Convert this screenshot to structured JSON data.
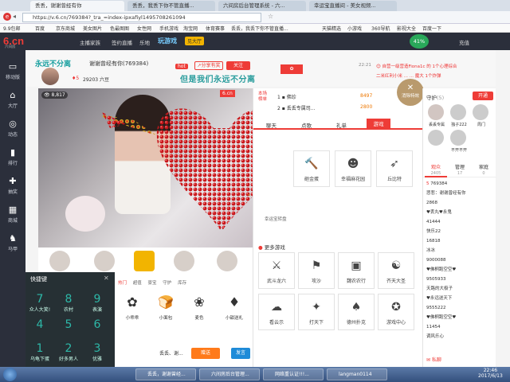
{
  "browser": {
    "tabs": [
      {
        "label": "丢丢，谢谢曾经有你",
        "active": true
      },
      {
        "label": "丢丢，我丢下你不管直播...",
        "active": false
      },
      {
        "label": "六间房后台管理系统 - 六...",
        "active": false
      },
      {
        "label": "幸运宝直播间 - 美女视频...",
        "active": false
      }
    ],
    "url": "https://v.6.cn/769384?_tra_=index-ipxafiyl1495708261094",
    "bookmarks": [
      "9.9包邮",
      "百度",
      "京东商城",
      "美女图片",
      "色最图图",
      "女性网",
      "手机游戏",
      "淘宝网",
      "体育赛事",
      "丢丢，我丢下你不管直播...",
      "天猫精选",
      "小游戏",
      "360导航",
      "影视大全",
      "百度一下"
    ]
  },
  "topbar": {
    "logo": "6.cn",
    "logo_sub": "六间房",
    "items": [
      "主播家族",
      "签约直播",
      "乐地"
    ],
    "game_label": "玩游戏",
    "badge": "见大厅",
    "user": "充值"
  },
  "sidebar": {
    "items": [
      {
        "icon": "monitor-icon",
        "label": "移动版"
      },
      {
        "icon": "house-icon",
        "label": "大厅"
      },
      {
        "icon": "compass-icon",
        "label": "动态"
      },
      {
        "icon": "chart-icon",
        "label": "排行"
      },
      {
        "icon": "gift-icon",
        "label": "抽奖"
      },
      {
        "icon": "shop-icon",
        "label": "商城"
      },
      {
        "icon": "horse-icon",
        "label": "马甲"
      }
    ]
  },
  "room": {
    "banner_text": "永远不分离",
    "title": "谢谢曾经有你(769384)",
    "level": "5",
    "fans": "29203",
    "six_beans_label": "六豆",
    "hot_label": "hot",
    "share_label": "分享有奖",
    "follow_label": "关注",
    "subtitle_banner": "但是我们永远不分离",
    "stage_counter": "8,817"
  },
  "right_panel": {
    "rank_header": "本场榜单",
    "rank": [
      {
        "pos": "1",
        "name": "佛珍",
        "value": "8497"
      },
      {
        "pos": "2",
        "name": "丢丢专属司...",
        "value": "2800"
      }
    ],
    "announce_time": "22:21",
    "announce_lines": [
      "😊 自营一级营造Fiona1c 的 1个心理综合",
      "二米红利小米 ... ... 魔大 1个炸弹"
    ],
    "tabs": [
      "聊天",
      "点歌",
      "礼单",
      "游戏"
    ],
    "active_tab": "游戏",
    "games_top": [
      {
        "label": "砸金蛋"
      },
      {
        "label": "幸福麻花园"
      },
      {
        "label": "丘比特"
      }
    ],
    "lucky_label": "幸运宝转盘",
    "more_games_title": "更多游戏",
    "games_more": [
      {
        "label": "武斗龙六"
      },
      {
        "label": "攻沙"
      },
      {
        "label": "魏农农行"
      },
      {
        "label": "齐天大圣"
      },
      {
        "label": "看云示"
      },
      {
        "label": "打天下"
      },
      {
        "label": "德州扑克"
      },
      {
        "label": "游戏中心"
      }
    ],
    "close_effects": "消除特效"
  },
  "far_right": {
    "guard_label": "守护",
    "guard_count": "(5)",
    "open_label": "开通",
    "guards": [
      "丢丢专属",
      "独子222",
      "周门",
      "",
      "不开不开"
    ],
    "audience_tabs": [
      {
        "label": "观众",
        "count": "2405"
      },
      {
        "label": "管理",
        "count": "17"
      },
      {
        "label": "家庭",
        "count": "0"
      }
    ],
    "audience": [
      {
        "lvl": "5",
        "name": "769384"
      },
      {
        "lvl": "",
        "name": "悲悲：谢谢曾经有你"
      },
      {
        "lvl": "",
        "name": "2868"
      },
      {
        "lvl": "",
        "name": "♥丢丸♥永鬼"
      },
      {
        "lvl": "",
        "name": "41444"
      },
      {
        "lvl": "",
        "name": "快乐22"
      },
      {
        "lvl": "",
        "name": "16818"
      },
      {
        "lvl": "",
        "name": "冰冰"
      },
      {
        "lvl": "",
        "name": "9000088"
      },
      {
        "lvl": "",
        "name": "♥佛桐跑空空♥"
      },
      {
        "lvl": "",
        "name": "9505933"
      },
      {
        "lvl": "",
        "name": "天路的大极子"
      },
      {
        "lvl": "",
        "name": "♥永远送天下"
      },
      {
        "lvl": "",
        "name": "9555222"
      },
      {
        "lvl": "",
        "name": "♥佛桐跑空空♥"
      },
      {
        "lvl": "",
        "name": "11454"
      },
      {
        "lvl": "",
        "name": "调风乐心"
      }
    ],
    "chat_label": "私聊"
  },
  "gift_bar": {
    "tabs": [
      "热门",
      "超值",
      "豪宝",
      "守护",
      "库存"
    ],
    "gifts": [
      "小乖乖",
      "小面包",
      "麦色",
      "小甜送礼"
    ],
    "send_to": "丢丢、谢...",
    "send_label": "赠送",
    "chat_send": "发言"
  },
  "shortcuts": {
    "title": "快捷键",
    "keys": [
      {
        "key": "7",
        "label": "众人大笑!"
      },
      {
        "key": "8",
        "label": "农村"
      },
      {
        "key": "9",
        "label": "表演"
      },
      {
        "key": "4",
        "label": ""
      },
      {
        "key": "5",
        "label": ""
      },
      {
        "key": "6",
        "label": ""
      },
      {
        "key": "1",
        "label": "乌龟下蛋"
      },
      {
        "key": "2",
        "label": "好多男人"
      },
      {
        "key": "3",
        "label": "优雅"
      }
    ]
  },
  "taskbar": {
    "items": [
      "丢丢，谢谢曾经...",
      "六间房后台管理...",
      "网络重认证!!!...",
      "langman0114"
    ],
    "time": "22:46",
    "date": "2017/6/13"
  },
  "percent_badge": "41%",
  "colors": {
    "brand": "#ee3c37",
    "topbar": "#2b2f3b",
    "accent_orange": "#ff7a1a",
    "teal": "#2db8a8"
  }
}
